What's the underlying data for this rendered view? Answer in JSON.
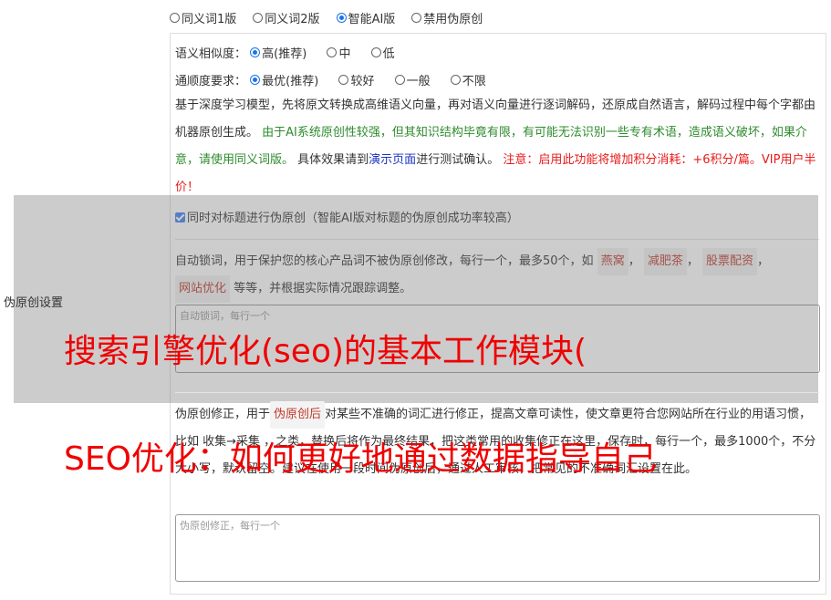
{
  "modes": [
    {
      "label": "同义词1版",
      "selected": false
    },
    {
      "label": "同义词2版",
      "selected": false
    },
    {
      "label": "智能AI版",
      "selected": true
    },
    {
      "label": "禁用伪原创",
      "selected": false
    }
  ],
  "similarity": {
    "label": "语义相似度：",
    "options": [
      "高(推荐)",
      "中",
      "低"
    ],
    "selected_index": 0
  },
  "fluency": {
    "label": "通顺度要求：",
    "options": [
      "最优(推荐)",
      "较好",
      "一般",
      "不限"
    ],
    "selected_index": 0
  },
  "description": {
    "part1": "基于深度学习模型，先将原文转换成高维语义向量，再对语义向量进行逐词解码，还原成自然语言，解码过程中每个字都由机器原创生成。",
    "green": "由于AI系统原创性较强，但其知识结构毕竟有限，有可能无法识别一些专有术语，造成语义破坏，如果介意，请使用同义词版。",
    "part2": "具体效果请到",
    "link": "演示页面",
    "part3": "进行测试确认。",
    "red": "注意：启用此功能将增加积分消耗：+6积分/篇。VIP用户半价！"
  },
  "title_checkbox": {
    "label": "同时对标题进行伪原创（智能AI版对标题的伪原创成功率较高）",
    "checked": true
  },
  "side_label": "伪原创设置",
  "lock_words": {
    "intro": "自动锁词，用于保护您的核心产品词不被伪原创修改，每行一个，最多50个，如",
    "examples": [
      "燕窝",
      "减肥茶",
      "股票配资",
      "网站优化"
    ],
    "outro": "等等，并根据实际情况跟踪调整。",
    "placeholder": "自动锁词，每行一个"
  },
  "correction": {
    "intro": "伪原创修正，用于",
    "tag": "伪原创后",
    "rest": "对某些不准确的词汇进行修正，提高文章可读性，使文章更符合您网站所在行业的用语习惯，比如 收集→采集 ，之类，替换后将作为最终结果，把这类常用的收集修正在这里，保存时，每行一个，最多1000个，不分大小写，默认留空。建议在使用一段时间伪原创后，通过人工审核，把常见的不准确词汇设置在此。",
    "placeholder": "伪原创修正，每行一个"
  },
  "banners": {
    "top": "搜索引擎优化(seo)的基本工作模块(",
    "bottom": "SEO优化：如何更好地通过数据指导自己"
  }
}
